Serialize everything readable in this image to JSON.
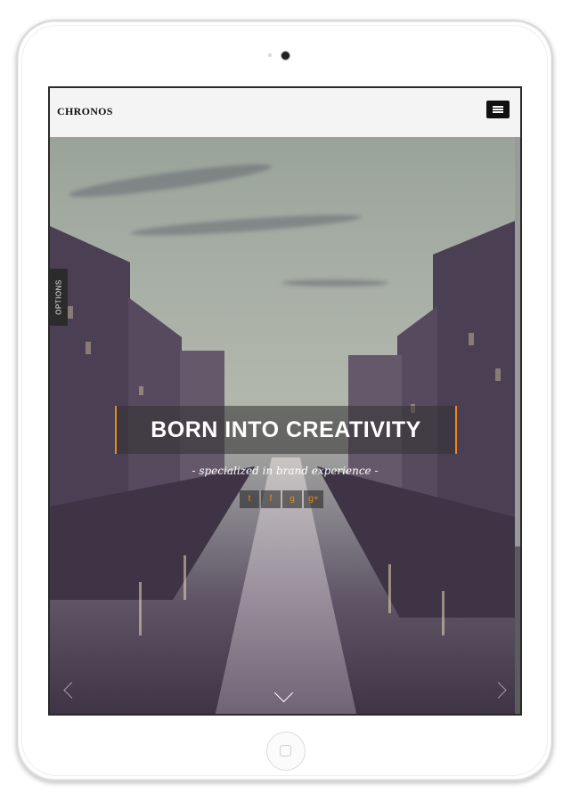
{
  "header": {
    "logo_text": "CHRONOS",
    "menu_icon": "hamburger-icon"
  },
  "sidebar_tab": {
    "label": "OPTIONS"
  },
  "hero": {
    "headline": "BORN INTO CREATIVITY",
    "tagline": "- specialized in brand experience -",
    "accent_color": "#e88a1a",
    "social_icons": [
      "twitter-icon",
      "facebook-icon",
      "github-icon",
      "google-plus-icon"
    ],
    "social_glyphs": [
      "t",
      "f",
      "g",
      "g+"
    ]
  },
  "nav": {
    "scroll_down_icon": "chevron-down-icon",
    "prev_icon": "chevron-left-icon",
    "next_icon": "chevron-right-icon"
  }
}
